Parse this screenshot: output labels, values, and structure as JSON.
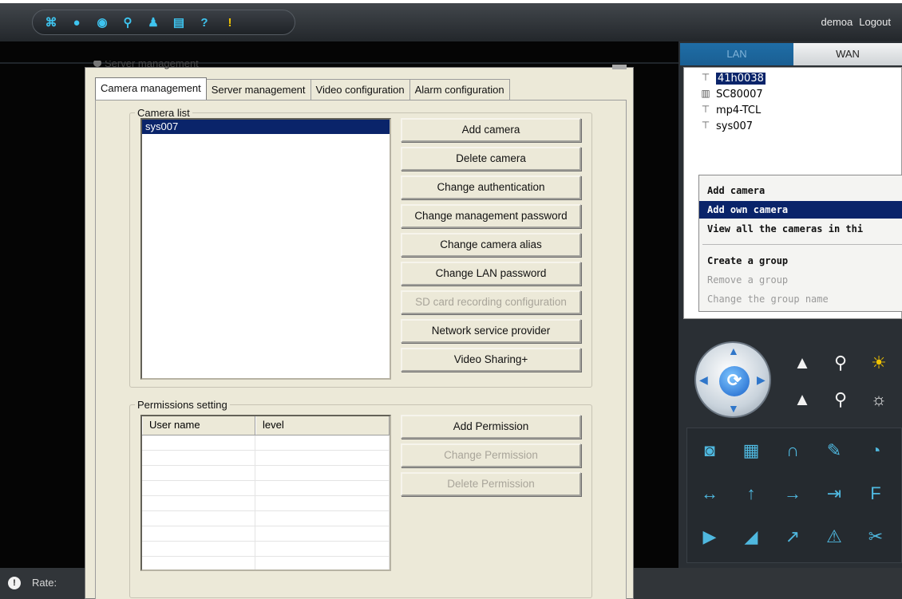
{
  "toolbar": {
    "icons": [
      {
        "name": "grid-view-icon",
        "glyph": "⌘"
      },
      {
        "name": "record-icon",
        "glyph": "●"
      },
      {
        "name": "snapshot-icon",
        "glyph": "◉"
      },
      {
        "name": "search-icon",
        "glyph": "⚲"
      },
      {
        "name": "user-icon",
        "glyph": "♟"
      },
      {
        "name": "storage-icon",
        "glyph": "▤"
      },
      {
        "name": "help-icon",
        "glyph": "?"
      },
      {
        "name": "info-icon",
        "glyph": "!"
      }
    ],
    "username": "demoa",
    "logout_label": "Logout"
  },
  "status_bar": {
    "icon_glyph": "!",
    "rate_label": "Rate:"
  },
  "right_panel": {
    "tabs": {
      "lan": "LAN",
      "wan": "WAN"
    },
    "devices": [
      "41h0038",
      "SC80007",
      "mp4-TCL",
      "sys007"
    ],
    "device_icons": [
      "camera-icon",
      "3g-camera-icon",
      "camera-icon",
      "camera-icon"
    ],
    "context_menu": {
      "items": [
        {
          "label": "Add camera",
          "state": "normal"
        },
        {
          "label": "Add own camera",
          "state": "highlighted"
        },
        {
          "label": "View all the cameras in thi",
          "state": "normal"
        },
        {
          "label": "Create a group",
          "state": "normal"
        },
        {
          "label": "Remove a group",
          "state": "disabled"
        },
        {
          "label": "Change the group name",
          "state": "disabled"
        }
      ]
    },
    "ptz": {
      "center_glyph": "⟳",
      "buttons": [
        {
          "name": "zoom-in-icon",
          "glyph": "▲"
        },
        {
          "name": "focus-in-icon",
          "glyph": "⚲"
        },
        {
          "name": "brightness-up-icon",
          "glyph": "☀"
        },
        {
          "name": "zoom-out-icon",
          "glyph": "▲"
        },
        {
          "name": "focus-out-icon",
          "glyph": "⚲"
        },
        {
          "name": "brightness-down-icon",
          "glyph": "☼"
        }
      ]
    },
    "control_grid": [
      {
        "name": "camera-icon",
        "glyph": "◙"
      },
      {
        "name": "clapper-icon",
        "glyph": "▦"
      },
      {
        "name": "headphones-icon",
        "glyph": "∩"
      },
      {
        "name": "microphone-icon",
        "glyph": "✎"
      },
      {
        "name": "timer-icon",
        "glyph": "◔"
      },
      {
        "name": "horizontal-scan-icon",
        "glyph": "↔"
      },
      {
        "name": "up-arrow-icon",
        "glyph": "↑"
      },
      {
        "name": "right-arrow-icon",
        "glyph": "→"
      },
      {
        "name": "enter-icon",
        "glyph": "⇥"
      },
      {
        "name": "f-icon",
        "glyph": "F"
      },
      {
        "name": "horizontal-flip-icon",
        "glyph": "▶"
      },
      {
        "name": "vertical-flip-icon",
        "glyph": "◢"
      },
      {
        "name": "trend-icon",
        "glyph": "↗"
      },
      {
        "name": "alarm-icon",
        "glyph": "⚠"
      },
      {
        "name": "wrench-icon",
        "glyph": "✂"
      }
    ]
  },
  "dialog": {
    "title": "Server management",
    "tabs": [
      "Camera management",
      "Server management",
      "Video configuration",
      "Alarm configuration"
    ],
    "active_tab": "Camera management",
    "camera_list": {
      "legend": "Camera list",
      "items": [
        "sys007"
      ],
      "buttons": [
        {
          "label": "Add camera",
          "enabled": true
        },
        {
          "label": "Delete camera",
          "enabled": true
        },
        {
          "label": "Change authentication",
          "enabled": true
        },
        {
          "label": "Change management password",
          "enabled": true
        },
        {
          "label": "Change camera alias",
          "enabled": true
        },
        {
          "label": "Change LAN password",
          "enabled": true
        },
        {
          "label": "SD card recording configuration",
          "enabled": false
        },
        {
          "label": "Network service provider",
          "enabled": true
        },
        {
          "label": "Video Sharing+",
          "enabled": true
        }
      ]
    },
    "permissions": {
      "legend": "Permissions setting",
      "columns": [
        "User name",
        "level"
      ],
      "buttons": [
        {
          "label": "Add Permission",
          "enabled": true
        },
        {
          "label": "Change Permission",
          "enabled": false
        },
        {
          "label": "Delete Permission",
          "enabled": false
        }
      ]
    }
  }
}
